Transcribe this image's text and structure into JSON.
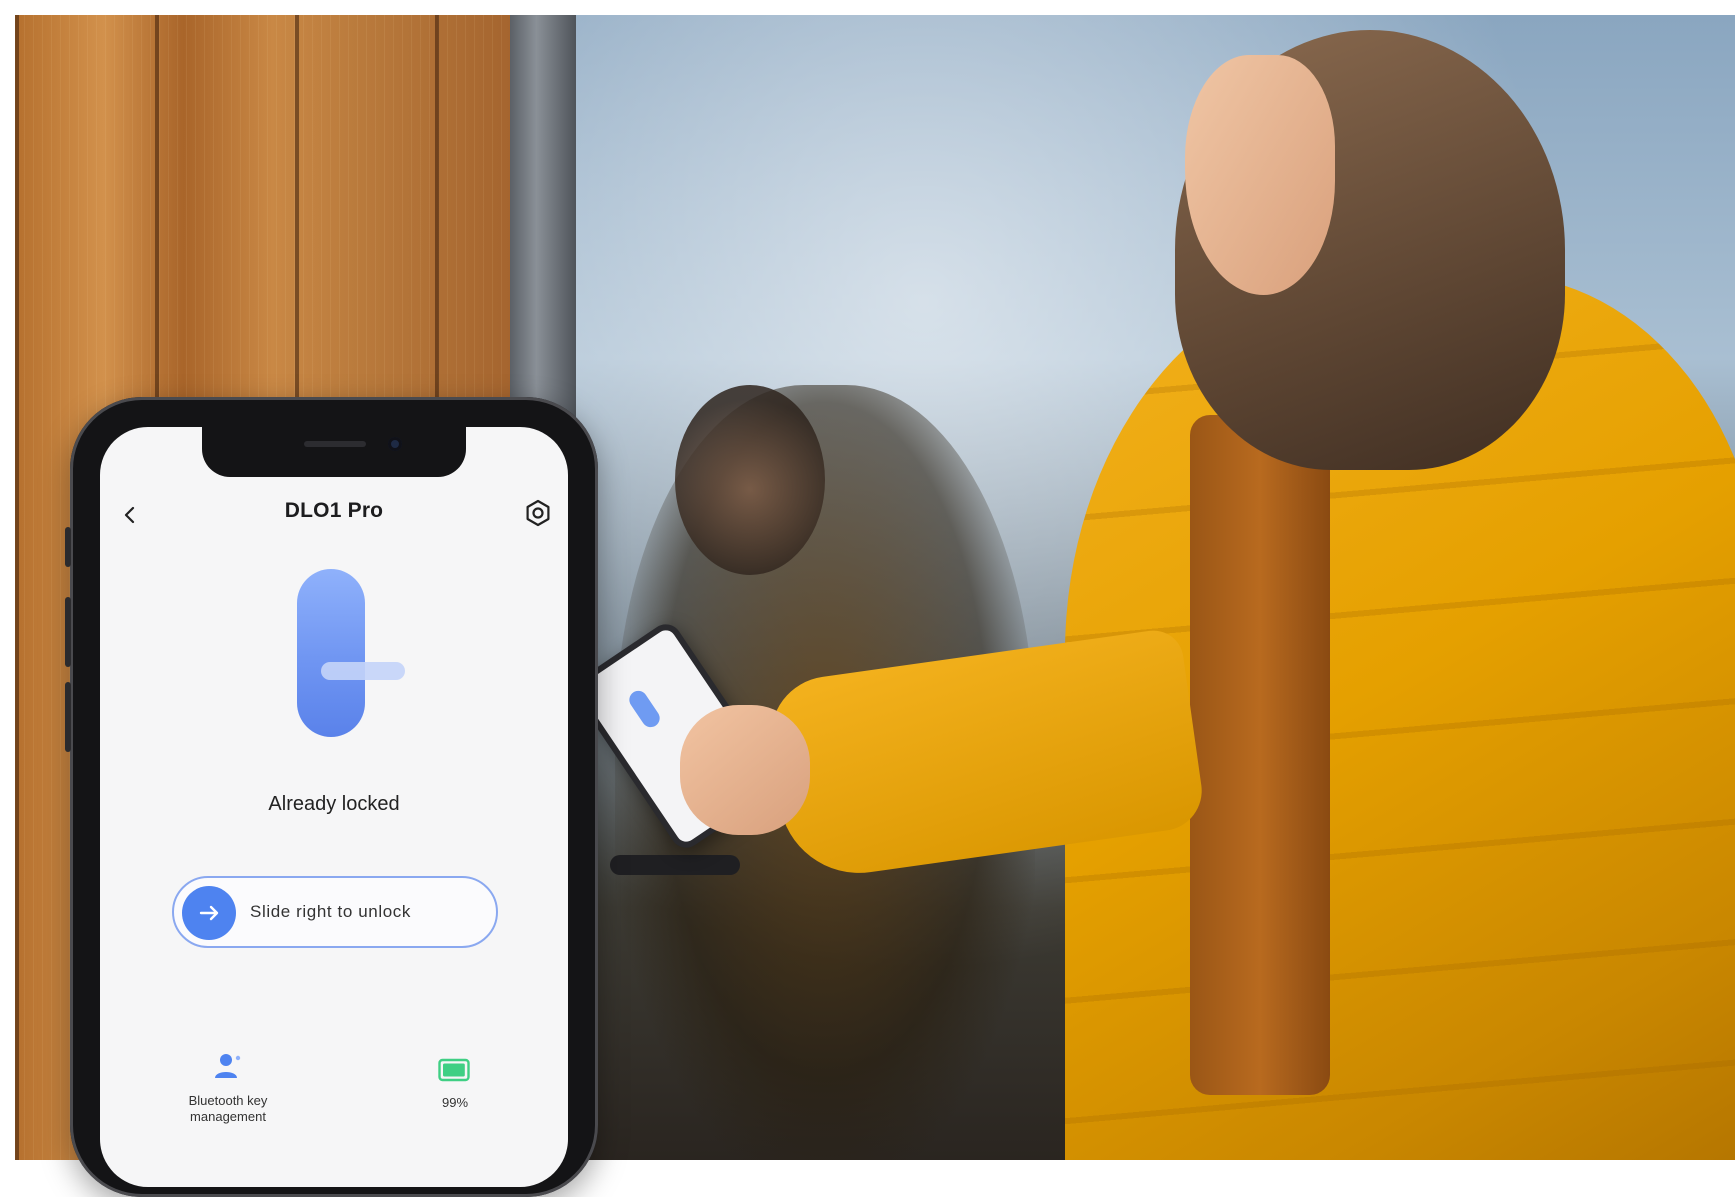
{
  "app": {
    "title": "DLO1 Pro",
    "status": "Already locked",
    "slider_label": "Slide right to unlock",
    "bottom_items": [
      {
        "label": "Bluetooth key management",
        "icon": "user-key-icon"
      },
      {
        "label": "99%",
        "icon": "battery-icon",
        "level": 0.99
      }
    ]
  },
  "colors": {
    "accent": "#4e83f0",
    "lock_gradient_top": "#8fb1fb",
    "lock_gradient_bottom": "#5a82ea",
    "battery": "#3fcf84",
    "jacket": "#e5a000"
  }
}
